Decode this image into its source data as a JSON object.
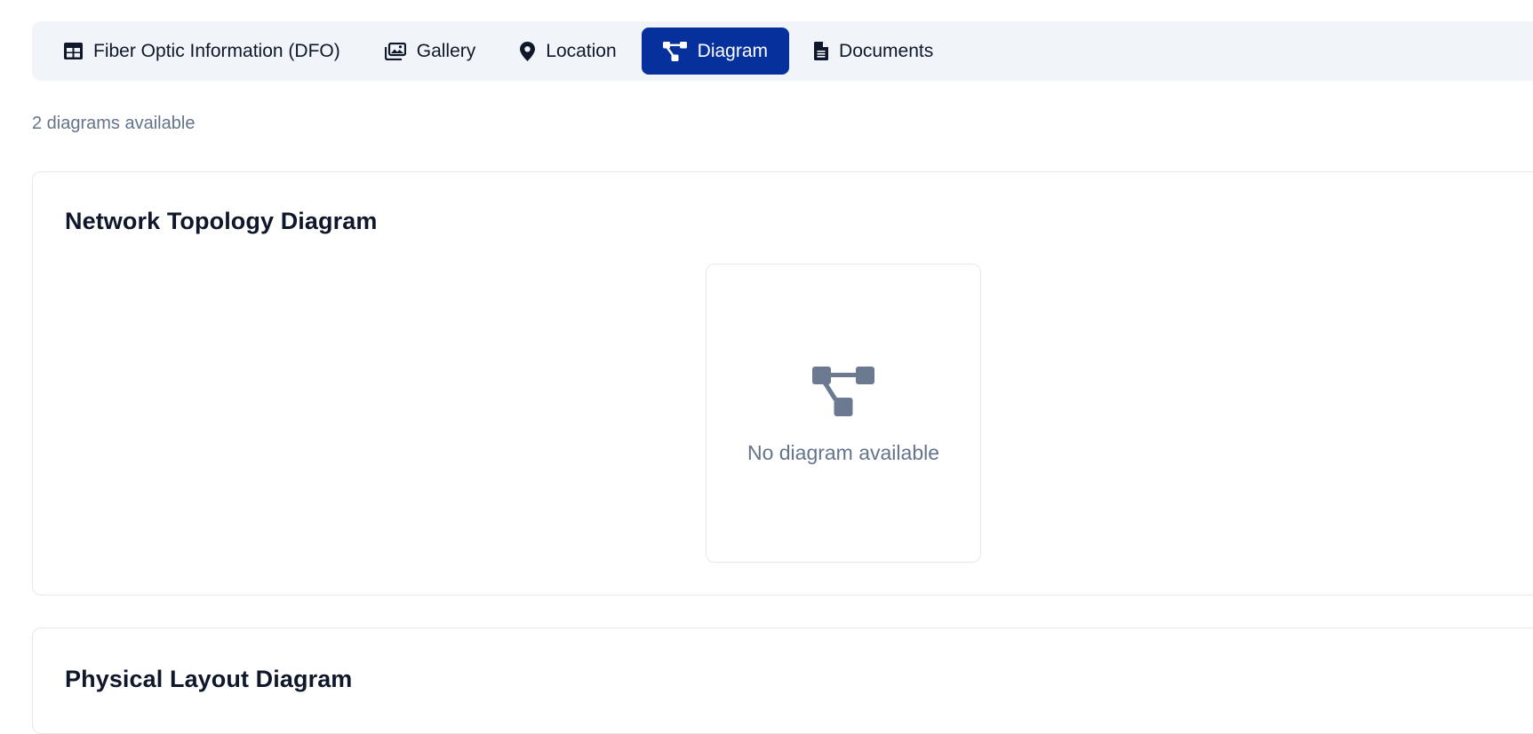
{
  "tabs": [
    {
      "label": "Fiber Optic Information (DFO)",
      "icon": "table-icon",
      "active": false
    },
    {
      "label": "Gallery",
      "icon": "images-icon",
      "active": false
    },
    {
      "label": "Location",
      "icon": "map-pin-icon",
      "active": false
    },
    {
      "label": "Diagram",
      "icon": "diagram-icon",
      "active": true
    },
    {
      "label": "Documents",
      "icon": "document-icon",
      "active": false
    }
  ],
  "diagram_count_text": "2 diagrams available",
  "diagrams": [
    {
      "title": "Network Topology Diagram",
      "empty_text": "No diagram available"
    },
    {
      "title": "Physical Layout Diagram"
    }
  ],
  "colors": {
    "active_tab_bg": "#06309c",
    "tabbar_bg": "#f1f5f9",
    "muted_text": "#64748b",
    "icon_muted": "#6b7a90"
  }
}
